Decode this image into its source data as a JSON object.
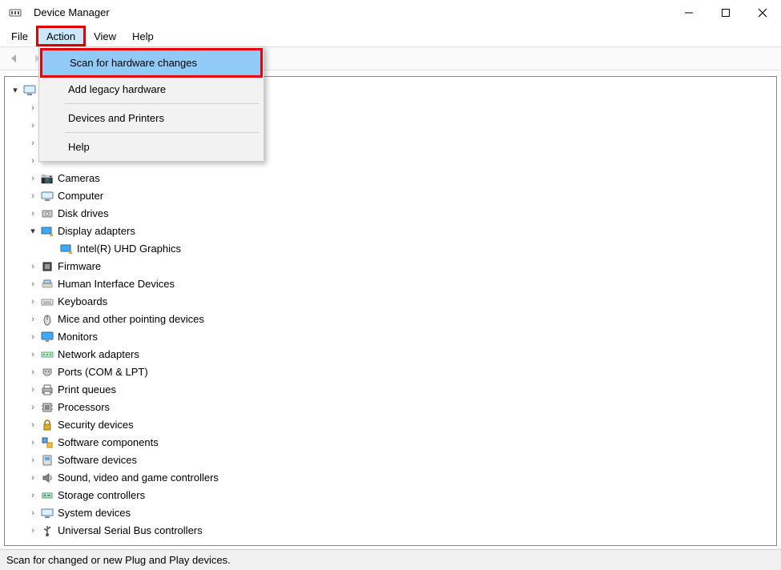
{
  "window": {
    "title": "Device Manager"
  },
  "menu": {
    "file": "File",
    "action": "Action",
    "view": "View",
    "help": "Help"
  },
  "dropdown": {
    "scan": "Scan for hardware changes",
    "legacy": "Add legacy hardware",
    "devprint": "Devices and Printers",
    "help": "Help"
  },
  "tree": {
    "root_hidden_1": "",
    "root_hidden_2": "",
    "root_hidden_3": "",
    "root_hidden_4": "",
    "cameras": "Cameras",
    "computer": "Computer",
    "disk": "Disk drives",
    "display": "Display adapters",
    "intel": "Intel(R) UHD Graphics",
    "firmware": "Firmware",
    "hid": "Human Interface Devices",
    "keyboards": "Keyboards",
    "mice": "Mice and other pointing devices",
    "monitors": "Monitors",
    "network": "Network adapters",
    "ports": "Ports (COM & LPT)",
    "printq": "Print queues",
    "proc": "Processors",
    "security": "Security devices",
    "swcomp": "Software components",
    "swdev": "Software devices",
    "sound": "Sound, video and game controllers",
    "storage": "Storage controllers",
    "system": "System devices",
    "usb": "Universal Serial Bus controllers"
  },
  "status": {
    "text": "Scan for changed or new Plug and Play devices."
  }
}
